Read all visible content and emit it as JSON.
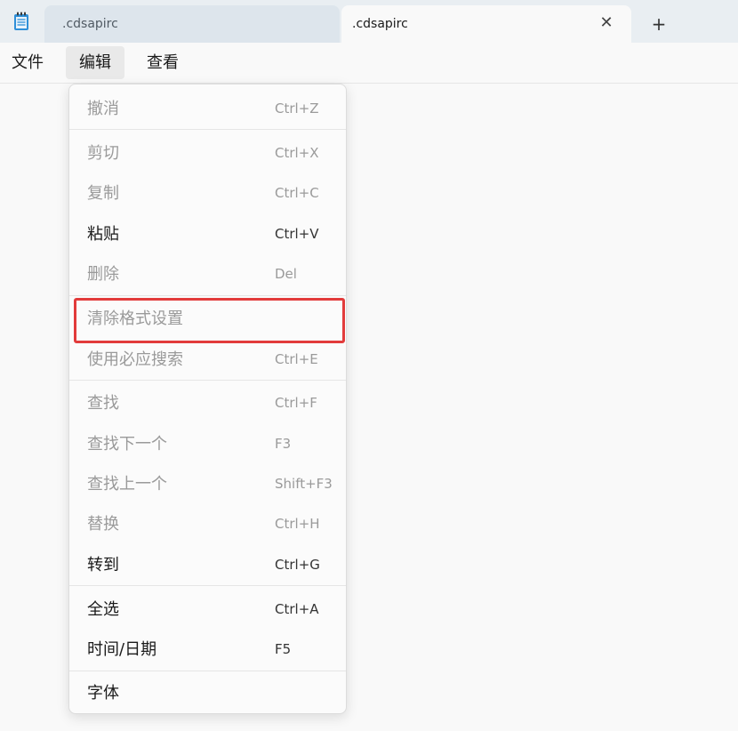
{
  "tabs": [
    {
      "label": ".cdsapirc"
    },
    {
      "label": ".cdsapirc"
    }
  ],
  "tab_close_glyph": "✕",
  "tab_new_glyph": "+",
  "menubar": {
    "file": "文件",
    "edit": "编辑",
    "view": "查看"
  },
  "edit_menu": {
    "items": [
      {
        "label": "撤消",
        "shortcut": "Ctrl+Z",
        "enabled": false
      },
      {
        "label": "剪切",
        "shortcut": "Ctrl+X",
        "enabled": false
      },
      {
        "label": "复制",
        "shortcut": "Ctrl+C",
        "enabled": false
      },
      {
        "label": "粘贴",
        "shortcut": "Ctrl+V",
        "enabled": true
      },
      {
        "label": "删除",
        "shortcut": "Del",
        "enabled": false
      },
      {
        "label": "清除格式设置",
        "shortcut": "",
        "enabled": false
      },
      {
        "label": "使用必应搜索",
        "shortcut": "Ctrl+E",
        "enabled": false
      },
      {
        "label": "查找",
        "shortcut": "Ctrl+F",
        "enabled": false
      },
      {
        "label": "查找下一个",
        "shortcut": "F3",
        "enabled": false
      },
      {
        "label": "查找上一个",
        "shortcut": "Shift+F3",
        "enabled": false
      },
      {
        "label": "替换",
        "shortcut": "Ctrl+H",
        "enabled": false
      },
      {
        "label": "转到",
        "shortcut": "Ctrl+G",
        "enabled": true
      },
      {
        "label": "全选",
        "shortcut": "Ctrl+A",
        "enabled": true
      },
      {
        "label": "时间/日期",
        "shortcut": "F5",
        "enabled": true
      },
      {
        "label": "字体",
        "shortcut": "",
        "enabled": true
      }
    ]
  },
  "colors": {
    "highlight_border": "#e23b3b",
    "disabled_text": "#9a9a9a",
    "enabled_text": "#1a1a1a",
    "titlebar_bg": "#e9eef2"
  },
  "icons": {
    "app": "notepad-icon",
    "close": "close-icon",
    "new_tab": "plus-icon"
  }
}
